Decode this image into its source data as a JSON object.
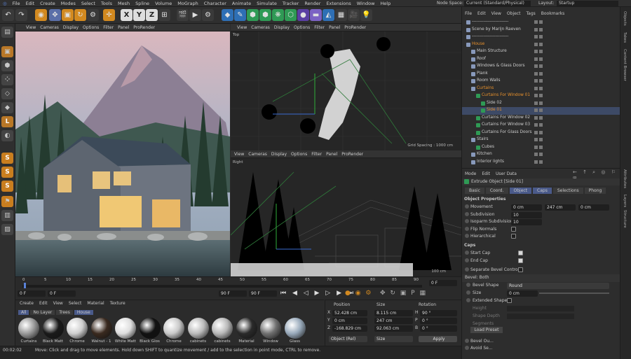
{
  "menu": [
    "File",
    "Edit",
    "Create",
    "Modes",
    "Select",
    "Tools",
    "Mesh",
    "Spline",
    "Volume",
    "MoGraph",
    "Character",
    "Animate",
    "Simulate",
    "Tracker",
    "Render",
    "Extensions",
    "Window",
    "Help"
  ],
  "nodespace_label": "Node Space:",
  "nodespace_value": "Current (Standard/Physical)",
  "layout_label": "Layout:",
  "layout_value": "Startup",
  "vp1_menu": [
    "View",
    "Cameras",
    "Display",
    "Options",
    "Filter",
    "Panel",
    "ProRender"
  ],
  "vp2_menu": [
    "View",
    "Cameras",
    "Display",
    "Options",
    "Filter",
    "Panel",
    "ProRender"
  ],
  "vp2_name": "Top",
  "vp2_grid": "Grid Spacing : 1000 cm",
  "vp3_menu": [
    "View",
    "Cameras",
    "Display",
    "Options",
    "Filter",
    "Panel",
    "ProRender"
  ],
  "vp3_name": "Right",
  "vp3_grid": "100 cm",
  "timeline": {
    "ticks": [
      "0",
      "5",
      "10",
      "15",
      "20",
      "25",
      "30",
      "35",
      "40",
      "45",
      "50",
      "55",
      "60",
      "65",
      "70",
      "75",
      "80",
      "85",
      "90"
    ],
    "frame_left": "0 F",
    "frame_start": "0 F",
    "frame_end": "90 F",
    "frame_end2": "90 F",
    "frame_right": "0 F"
  },
  "material_menu": [
    "Create",
    "Edit",
    "View",
    "Select",
    "Material",
    "Texture"
  ],
  "material_filters": [
    "All",
    "No Layer",
    "Trees",
    "House"
  ],
  "materials": [
    "Curtains",
    "Black Matt",
    "Chrome",
    "Walnut - 1",
    "White Matt",
    "Black Glos",
    "Chrome",
    "cabinets",
    "cabinets",
    "Material",
    "Window",
    "Glass"
  ],
  "coords": {
    "h_position": "Position",
    "h_size": "Size",
    "h_rotation": "Rotation",
    "rows": [
      {
        "axis": "X",
        "pos": "52.428 cm",
        "size": "8.115 cm",
        "raxis": "H",
        "rot": "90 °"
      },
      {
        "axis": "Y",
        "pos": "0 cm",
        "size": "247 cm",
        "raxis": "P",
        "rot": "0 °"
      },
      {
        "axis": "Z",
        "pos": "-168.829 cm",
        "size": "92.063 cm",
        "raxis": "B",
        "rot": "0 °"
      }
    ],
    "mode1": "Object (Rel)",
    "mode2": "Size",
    "apply": "Apply"
  },
  "status": {
    "time": "00:02:02",
    "message": "Move: Click and drag to move elements. Hold down SHIFT to quantize movement / add to the selection in point mode, CTRL to remove."
  },
  "objects_menu": [
    "File",
    "Edit",
    "View",
    "Object",
    "Tags",
    "Bookmarks"
  ],
  "objects": [
    {
      "name": "-------------------------",
      "indent": 0,
      "color": "#ccc"
    },
    {
      "name": "Scene by Marijn Raeven",
      "indent": 0,
      "color": "#ccc"
    },
    {
      "name": "-------------------------",
      "indent": 0,
      "color": "#ccc"
    },
    {
      "name": "House",
      "indent": 0,
      "color": "#e8912d"
    },
    {
      "name": "Main Structure",
      "indent": 1,
      "color": "#ccc"
    },
    {
      "name": "Roof",
      "indent": 1,
      "color": "#ccc"
    },
    {
      "name": "Windows & Glass Doors",
      "indent": 1,
      "color": "#ccc"
    },
    {
      "name": "Plank",
      "indent": 1,
      "color": "#ccc"
    },
    {
      "name": "Room Walls",
      "indent": 1,
      "color": "#ccc"
    },
    {
      "name": "Curtains",
      "indent": 1,
      "color": "#e8912d"
    },
    {
      "name": "Curtains For Window 01",
      "indent": 2,
      "color": "#e8912d"
    },
    {
      "name": "Side 02",
      "indent": 3,
      "color": "#ccc"
    },
    {
      "name": "Side 01",
      "indent": 3,
      "color": "#e8912d"
    },
    {
      "name": "Curtains For Window 02",
      "indent": 2,
      "color": "#ccc"
    },
    {
      "name": "Curtains For Window 03",
      "indent": 2,
      "color": "#ccc"
    },
    {
      "name": "Curtains For Glass Doors",
      "indent": 2,
      "color": "#ccc"
    },
    {
      "name": "Stairs",
      "indent": 1,
      "color": "#ccc"
    },
    {
      "name": "Cubes",
      "indent": 2,
      "color": "#ccc"
    },
    {
      "name": "Kitchen",
      "indent": 1,
      "color": "#ccc"
    },
    {
      "name": "Interior lights",
      "indent": 1,
      "color": "#ccc"
    }
  ],
  "attr_menu": [
    "Mode",
    "Edit",
    "User Data"
  ],
  "attr_title": "Extrude Object [Side 01]",
  "attr_tabs": [
    "Basic",
    "Coord.",
    "Object",
    "Caps",
    "Selections",
    "Phong"
  ],
  "obj_props": "Object Properties",
  "props": [
    {
      "label": "Movement",
      "v1": "0 cm",
      "v2": "247 cm",
      "v3": "0 cm"
    },
    {
      "label": "Subdivision",
      "v1": "10"
    },
    {
      "label": "Isoparm Subdivision",
      "v1": "10"
    },
    {
      "label": "Flip Normals"
    },
    {
      "label": "Hierarchical"
    }
  ],
  "caps_title": "Caps",
  "start_cap": "Start Cap",
  "end_cap": "End Cap",
  "sep_bevel": "Separate Bevel Controls",
  "bevel_both": "Bevel: Both",
  "bevel_shape": "Bevel Shape",
  "bevel_shape_val": "Round",
  "size": "Size",
  "size_val": "0 cm",
  "ext_shape": "Extended Shape",
  "height": "Height",
  "shape_depth": "Shape Depth",
  "segments": "Segments",
  "load_preset": "Load Preset",
  "bevel_out": "Bevel Ou...",
  "avoid": "Avoid Se...",
  "right_tabs": [
    "Objects",
    "Takes",
    "Content Browser",
    "Attributes",
    "Layers",
    "Structure"
  ]
}
